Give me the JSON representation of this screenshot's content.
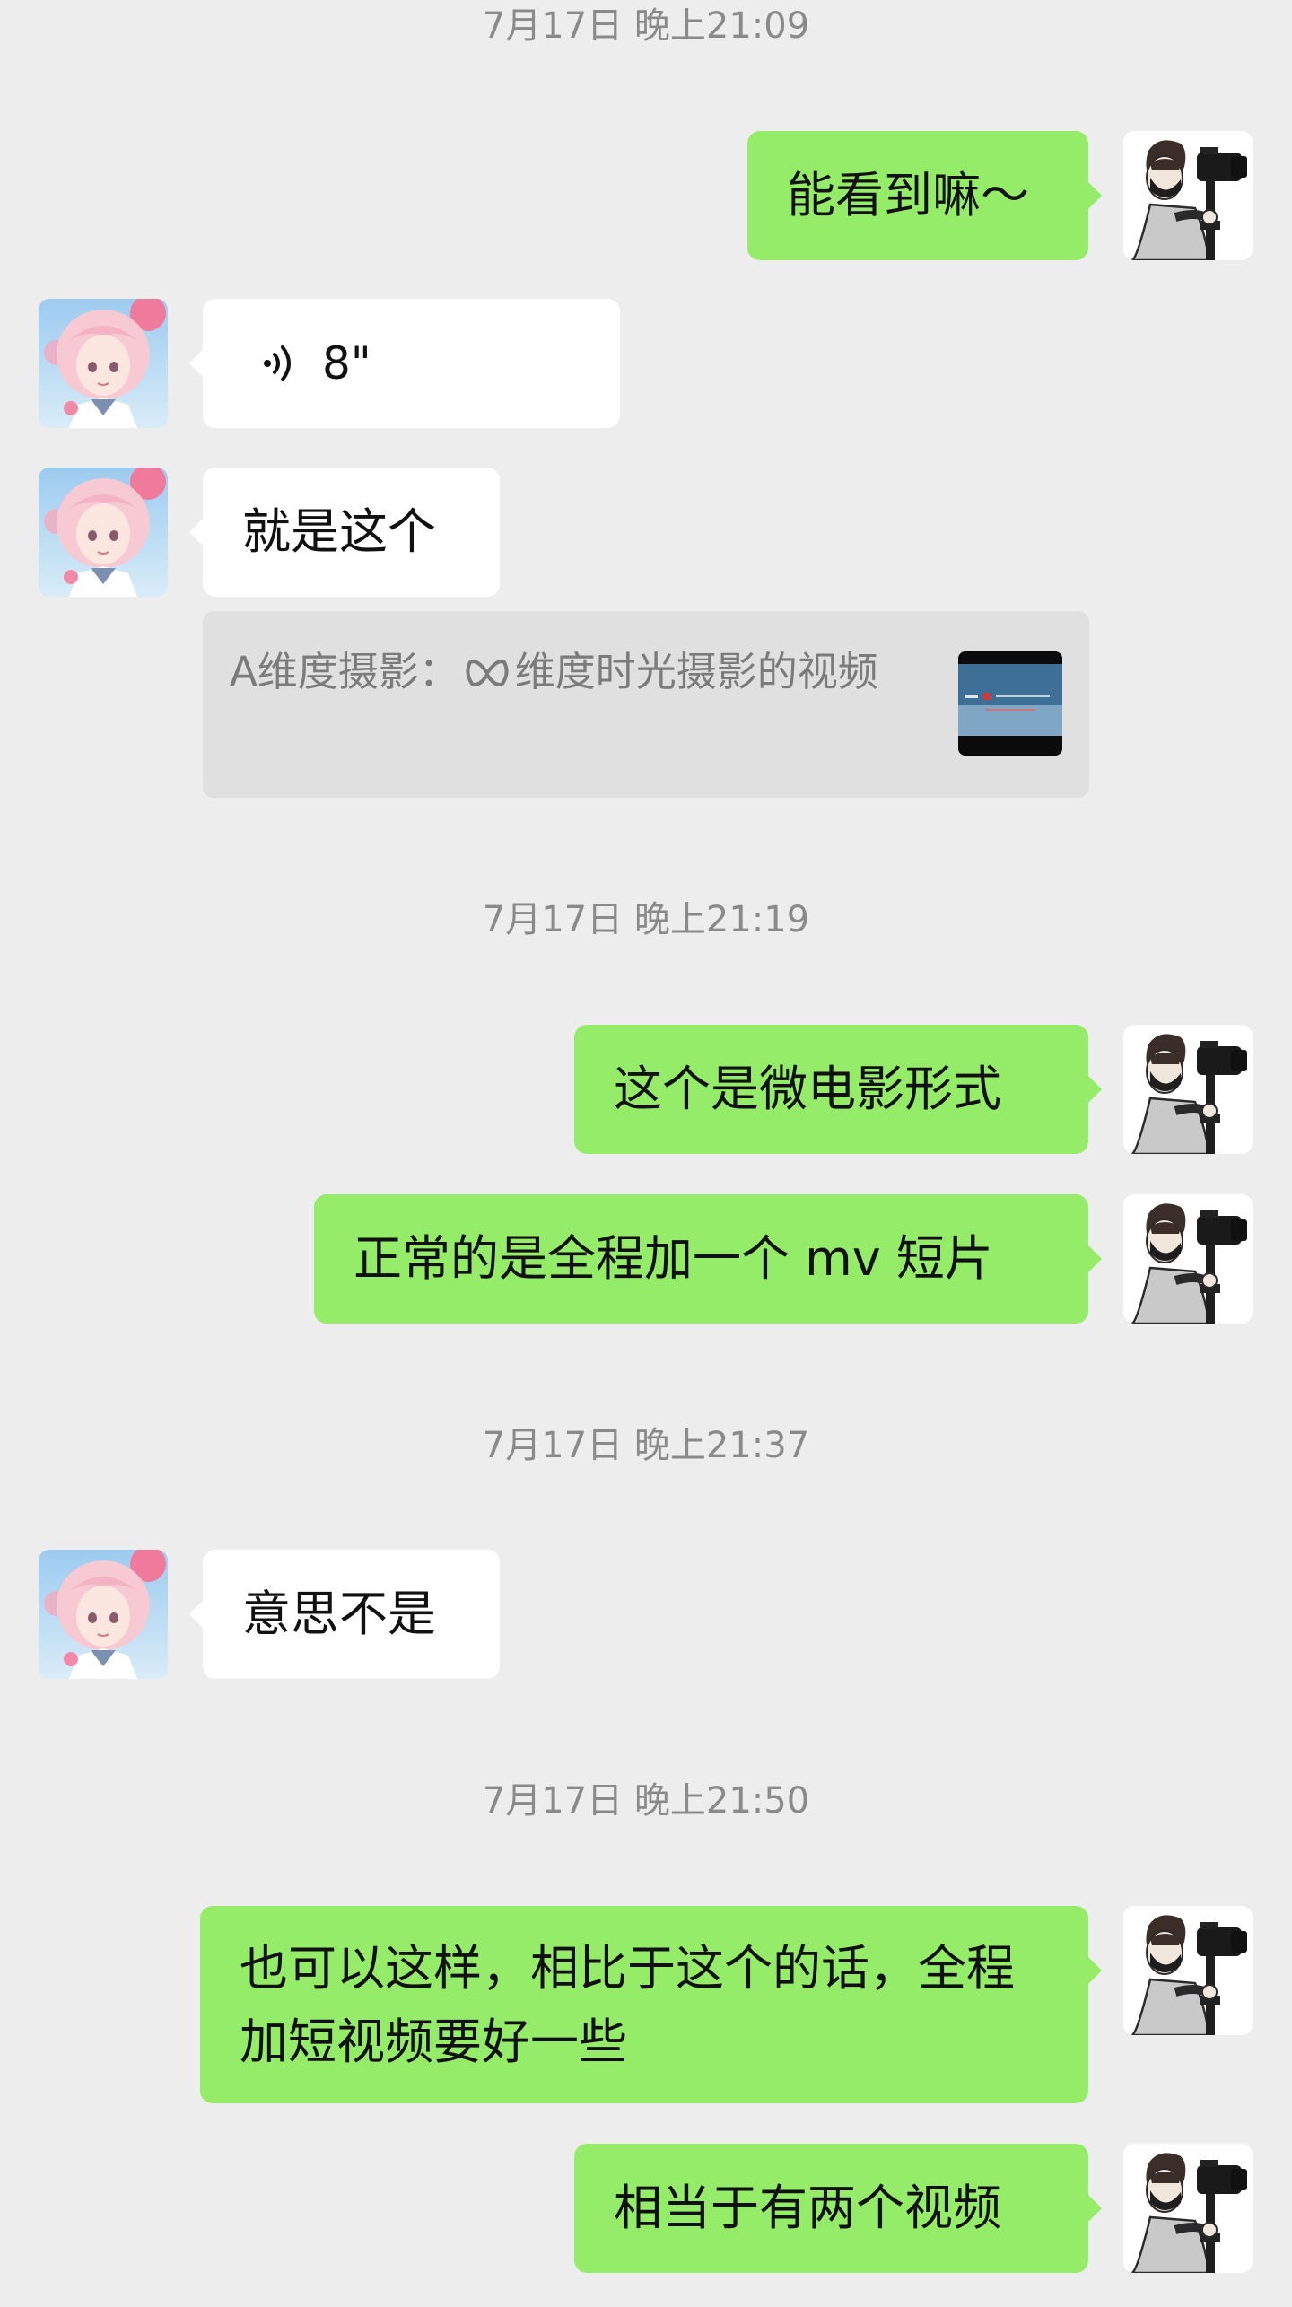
{
  "timestamps": [
    "7月17日 晚上21:09",
    "7月17日 晚上21:19",
    "7月17日 晚上21:37",
    "7月17日 晚上21:50"
  ],
  "messages": {
    "m1": "能看到嘛～",
    "voice_duration": "8\"",
    "m3": "就是这个",
    "quote_prefix": "A维度摄影：",
    "quote_text": "维度时光摄影的视频",
    "m4": "这个是微电影形式",
    "m5": "正常的是全程加一个 mv 短片",
    "m6": "意思不是",
    "m7": "也可以这样，相比于这个的话，全程加短视频要好一些",
    "m8": "相当于有两个视频"
  },
  "icons": {
    "left_avatar": "anime-girl-avatar",
    "right_avatar": "photographer-avatar",
    "voice": "voice-wave-icon",
    "quote_logo": "dimension-logo-icon"
  },
  "colors": {
    "background": "#EDEDED",
    "sent_bubble": "#95EC69",
    "received_bubble": "#FFFFFF",
    "timestamp_text": "#8A8A8A",
    "quote_bg": "#E0E0E0"
  }
}
